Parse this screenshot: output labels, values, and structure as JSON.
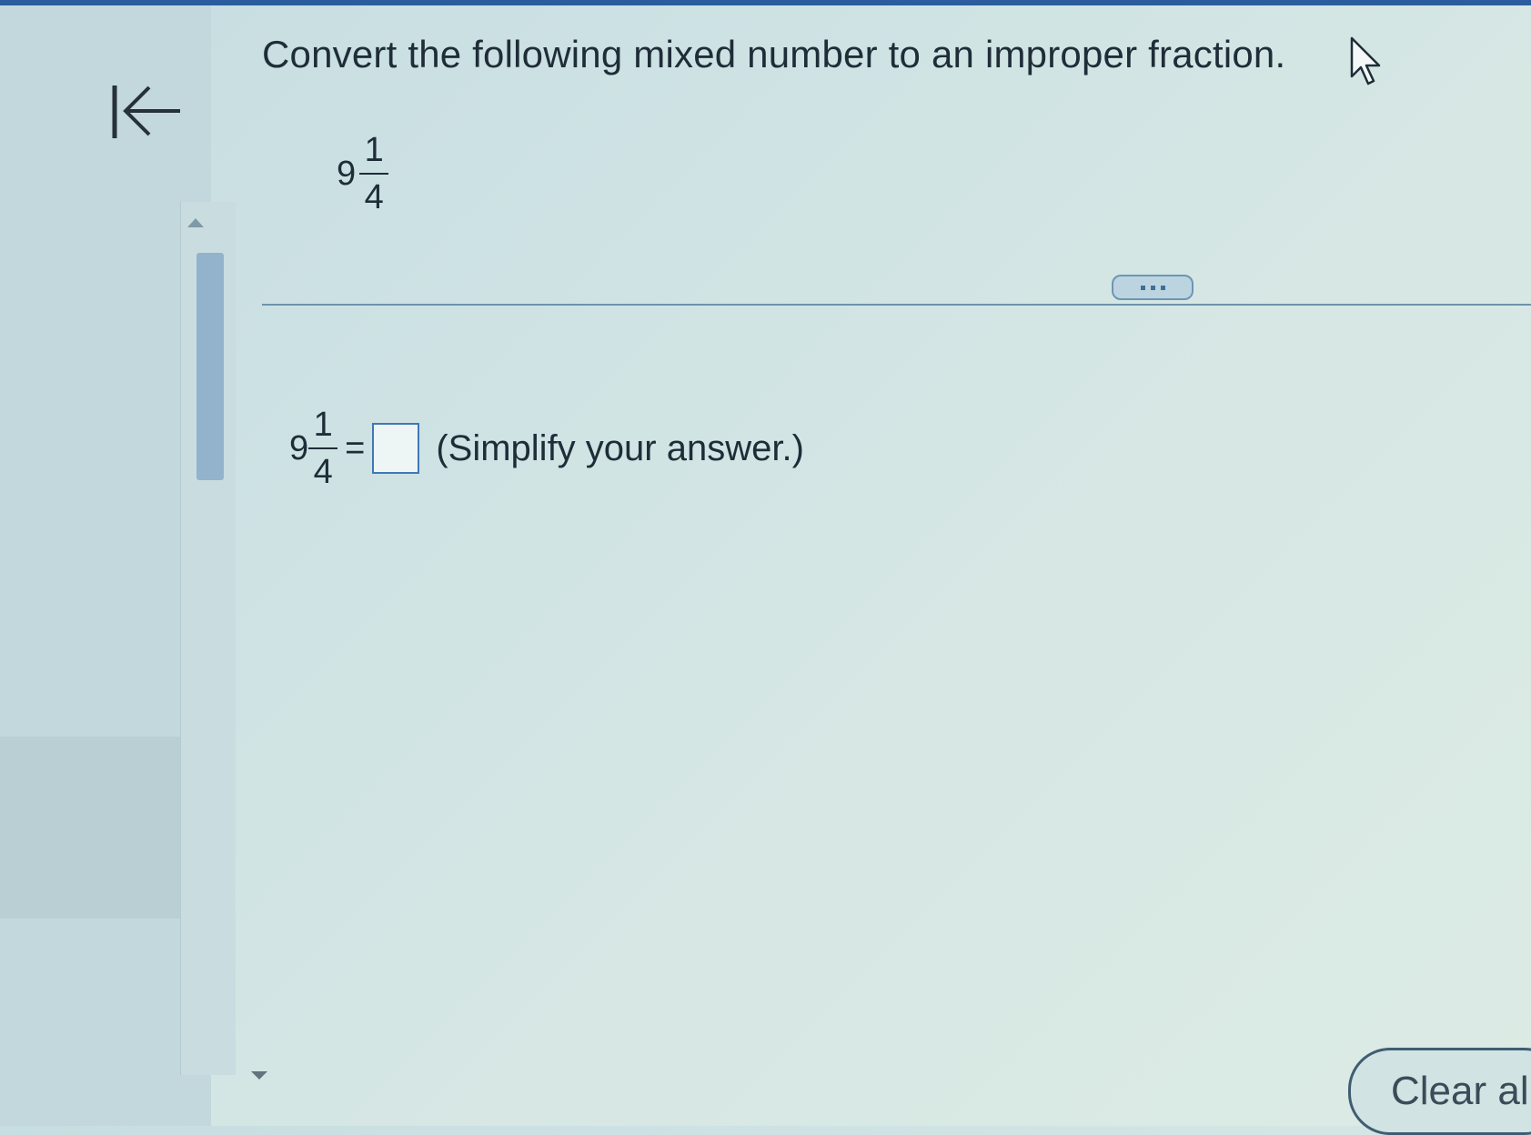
{
  "question": {
    "prompt": "Convert the following mixed number to an improper fraction."
  },
  "mixed_number": {
    "whole": "9",
    "numerator": "1",
    "denominator": "4"
  },
  "answer": {
    "whole": "9",
    "numerator": "1",
    "denominator": "4",
    "equals": "=",
    "input_value": "",
    "hint": "(Simplify your answer.)"
  },
  "toolbar": {
    "clear_all_label": "Clear all"
  },
  "icons": {
    "collapse": "collapse-left-icon",
    "more": "more-options-icon",
    "cursor": "mouse-pointer-icon"
  },
  "colors": {
    "top_bar": "#2b5d9e",
    "divider": "#6d93ad",
    "answer_box_border": "#3f78b5",
    "scroll_thumb": "#93b3cc"
  }
}
